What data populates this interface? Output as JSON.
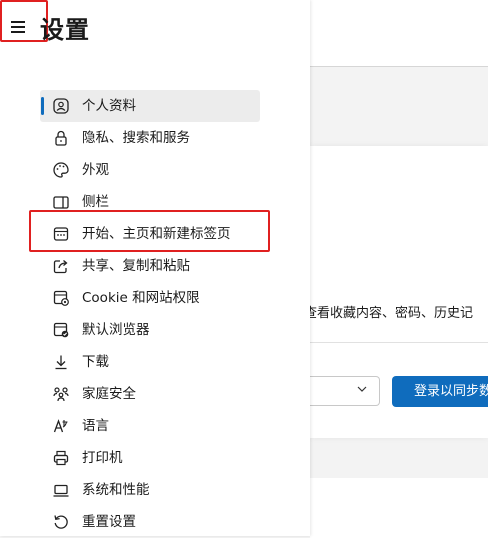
{
  "header": {
    "title": "设置",
    "menu_icon": "hamburger-menu-icon"
  },
  "sidebar": {
    "items": [
      {
        "label": "个人资料",
        "icon": "profile-icon",
        "active": true
      },
      {
        "label": "隐私、搜索和服务",
        "icon": "lock-icon"
      },
      {
        "label": "外观",
        "icon": "palette-icon"
      },
      {
        "label": "侧栏",
        "icon": "sidebar-icon"
      },
      {
        "label": "开始、主页和新建标签页",
        "icon": "home-grid-icon",
        "highlighted": true
      },
      {
        "label": "共享、复制和粘贴",
        "icon": "share-icon"
      },
      {
        "label": "Cookie 和网站权限",
        "icon": "site-permissions-icon"
      },
      {
        "label": "默认浏览器",
        "icon": "default-browser-icon"
      },
      {
        "label": "下载",
        "icon": "download-icon"
      },
      {
        "label": "家庭安全",
        "icon": "family-icon"
      },
      {
        "label": "语言",
        "icon": "language-icon"
      },
      {
        "label": "打印机",
        "icon": "printer-icon"
      },
      {
        "label": "系统和性能",
        "icon": "laptop-icon"
      },
      {
        "label": "重置设置",
        "icon": "reset-icon"
      }
    ]
  },
  "main": {
    "sync_description": "查看收藏内容、密码、历史记",
    "sync_button_label": "登录以同步数据"
  },
  "colors": {
    "accent": "#0f6cbd",
    "highlight_box": "#e02020",
    "active_bg": "#ececec"
  }
}
